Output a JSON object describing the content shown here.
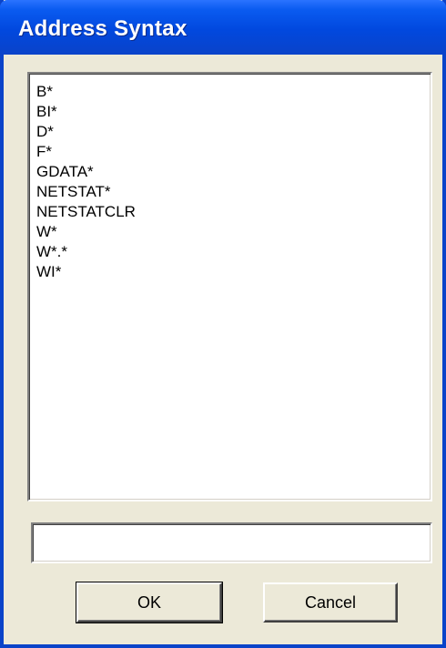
{
  "window": {
    "title": "Address Syntax"
  },
  "list": {
    "items": [
      "B*",
      "BI*",
      "D*",
      "F*",
      "GDATA*",
      "NETSTAT*",
      "NETSTATCLR",
      "W*",
      "W*.*",
      "WI*"
    ]
  },
  "input": {
    "value": ""
  },
  "buttons": {
    "ok_label": "OK",
    "cancel_label": "Cancel"
  },
  "colors": {
    "titlebar": "#0148de",
    "dialog_background": "#ece9d8"
  }
}
